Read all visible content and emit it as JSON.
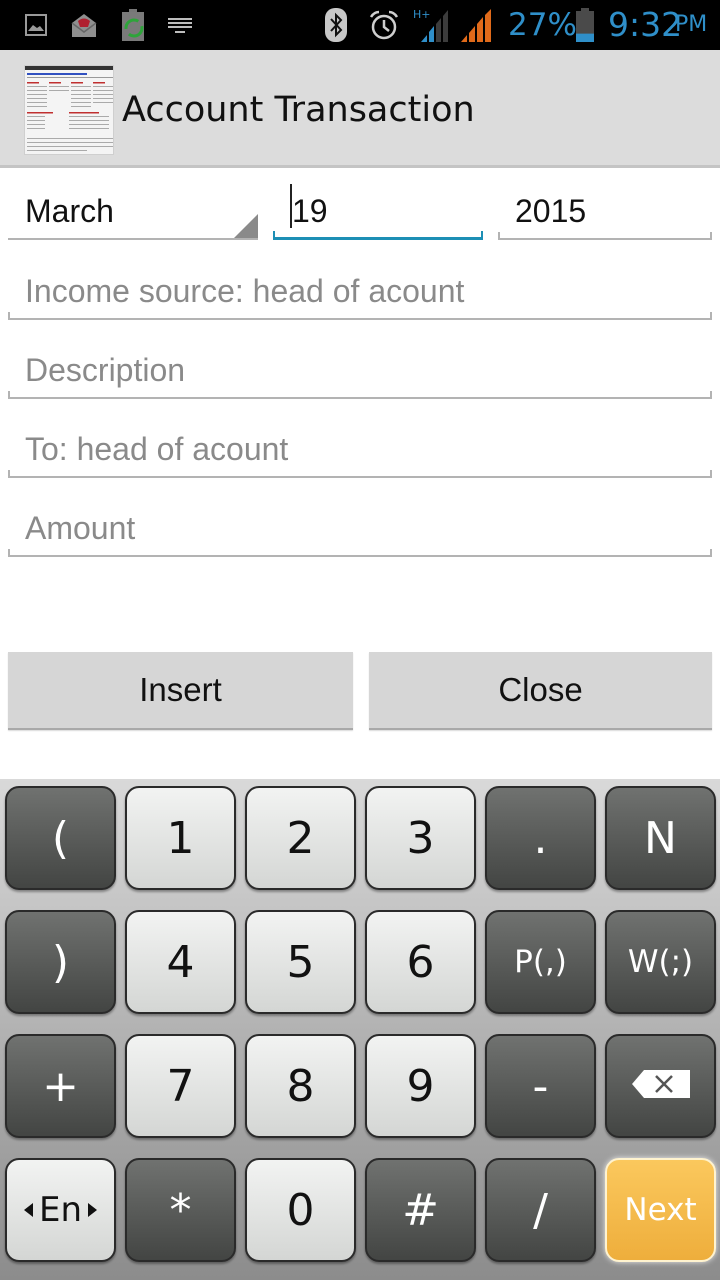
{
  "status_bar": {
    "left_icons": [
      "gallery-icon",
      "mail-icon",
      "battery-sync-icon",
      "keyboard-icon"
    ],
    "right_icons": [
      "bluetooth-icon",
      "alarm-icon",
      "signal-hplus-icon",
      "signal-icon",
      "battery-icon"
    ],
    "network_label": "H+",
    "battery_percent": "27%",
    "battery_level": 0.27,
    "time": "9:32",
    "ampm": "PM",
    "accent_color": "#2f8fc9"
  },
  "action_bar": {
    "title": "Account Transaction",
    "app_icon": "spreadsheet-thumbnail-icon"
  },
  "form": {
    "month": {
      "value": "March"
    },
    "day": {
      "value": "19",
      "focused": true
    },
    "year": {
      "value": "2015"
    },
    "income_source": {
      "value": "",
      "placeholder": "Income source: head of acount"
    },
    "description": {
      "value": "",
      "placeholder": "Description"
    },
    "to_account": {
      "value": "",
      "placeholder": "To: head of acount"
    },
    "amount": {
      "value": "",
      "placeholder": "Amount"
    },
    "focus_color": "#1d8fb5"
  },
  "buttons": {
    "insert": "Insert",
    "close": "Close"
  },
  "keyboard": {
    "rows": [
      [
        {
          "label": "(",
          "style": "dark"
        },
        {
          "label": "1",
          "style": "light"
        },
        {
          "label": "2",
          "style": "light"
        },
        {
          "label": "3",
          "style": "light"
        },
        {
          "label": ".",
          "style": "dark"
        },
        {
          "label": "N",
          "style": "dark"
        }
      ],
      [
        {
          "label": ")",
          "style": "dark"
        },
        {
          "label": "4",
          "style": "light"
        },
        {
          "label": "5",
          "style": "light"
        },
        {
          "label": "6",
          "style": "light"
        },
        {
          "label": "P(,)",
          "style": "dark"
        },
        {
          "label": "W(;)",
          "style": "dark"
        }
      ],
      [
        {
          "label": "+",
          "style": "dark"
        },
        {
          "label": "7",
          "style": "light"
        },
        {
          "label": "8",
          "style": "light"
        },
        {
          "label": "9",
          "style": "light"
        },
        {
          "label": "-",
          "style": "dark"
        },
        {
          "label": "",
          "style": "dark",
          "icon": "backspace-icon"
        }
      ],
      [
        {
          "label": "En",
          "style": "light",
          "icon": "language-switch-icon"
        },
        {
          "label": "*",
          "style": "dark"
        },
        {
          "label": "0",
          "style": "light"
        },
        {
          "label": "#",
          "style": "dark"
        },
        {
          "label": "/",
          "style": "dark"
        },
        {
          "label": "Next",
          "style": "next"
        }
      ]
    ],
    "next_color": "#f6bc4c"
  }
}
